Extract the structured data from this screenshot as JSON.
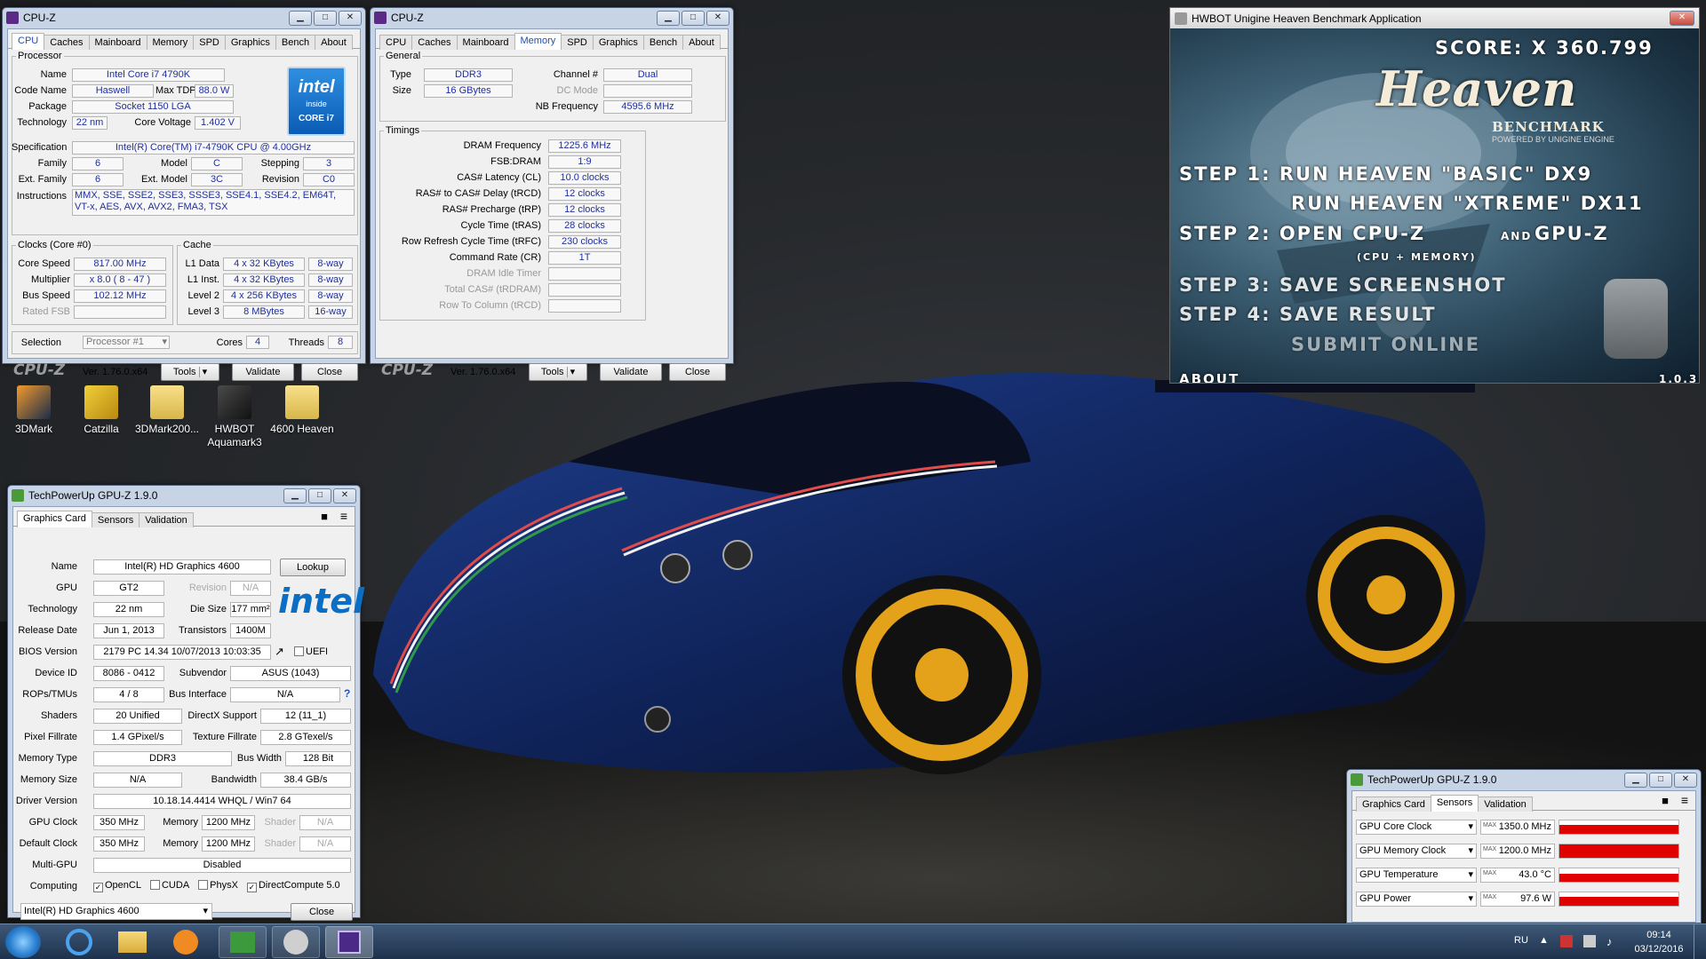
{
  "desktop": {
    "icons": [
      {
        "label": "3DMark"
      },
      {
        "label": "Catzilla"
      },
      {
        "label": "3DMark200..."
      },
      {
        "label": "HWBOT Aquamark3"
      },
      {
        "label": "4600 Heaven"
      }
    ]
  },
  "cpuz1": {
    "title": "CPU-Z",
    "tabs": [
      "CPU",
      "Caches",
      "Mainboard",
      "Memory",
      "SPD",
      "Graphics",
      "Bench",
      "About"
    ],
    "active_tab": "CPU",
    "processor": {
      "legend": "Processor",
      "name_label": "Name",
      "name": "Intel Core i7 4790K",
      "codename_label": "Code Name",
      "codename": "Haswell",
      "maxtdp_label": "Max TDP",
      "maxtdp": "88.0 W",
      "package_label": "Package",
      "package": "Socket 1150 LGA",
      "technology_label": "Technology",
      "technology": "22 nm",
      "corevoltage_label": "Core Voltage",
      "corevoltage": "1.402 V",
      "spec_label": "Specification",
      "spec": "Intel(R) Core(TM) i7-4790K CPU @ 4.00GHz",
      "family_label": "Family",
      "family": "6",
      "model_label": "Model",
      "model": "C",
      "stepping_label": "Stepping",
      "stepping": "3",
      "extfamily_label": "Ext. Family",
      "extfamily": "6",
      "extmodel_label": "Ext. Model",
      "extmodel": "3C",
      "revision_label": "Revision",
      "revision": "C0",
      "instructions_label": "Instructions",
      "instructions": "MMX, SSE, SSE2, SSE3, SSSE3, SSE4.1, SSE4.2, EM64T, VT-x, AES, AVX, AVX2, FMA3, TSX"
    },
    "badge": {
      "brand": "intel",
      "inside": "inside",
      "model": "CORE i7"
    },
    "clocks": {
      "legend": "Clocks (Core #0)",
      "corespeed_label": "Core Speed",
      "corespeed": "817.00 MHz",
      "multiplier_label": "Multiplier",
      "multiplier": "x 8.0 ( 8 - 47 )",
      "busspeed_label": "Bus Speed",
      "busspeed": "102.12 MHz",
      "ratedfsb_label": "Rated FSB",
      "ratedfsb": ""
    },
    "cache": {
      "legend": "Cache",
      "l1data_label": "L1 Data",
      "l1data": "4 x 32 KBytes",
      "l1data_way": "8-way",
      "l1inst_label": "L1 Inst.",
      "l1inst": "4 x 32 KBytes",
      "l1inst_way": "8-way",
      "l2_label": "Level 2",
      "l2": "4 x 256 KBytes",
      "l2_way": "8-way",
      "l3_label": "Level 3",
      "l3": "8 MBytes",
      "l3_way": "16-way"
    },
    "selection_label": "Selection",
    "selection": "Processor #1",
    "cores_label": "Cores",
    "cores": "4",
    "threads_label": "Threads",
    "threads": "8",
    "brand": "CPU-Z",
    "version": "Ver. 1.76.0.x64",
    "tools": "Tools",
    "validate": "Validate",
    "close": "Close"
  },
  "cpuz2": {
    "title": "CPU-Z",
    "tabs": [
      "CPU",
      "Caches",
      "Mainboard",
      "Memory",
      "SPD",
      "Graphics",
      "Bench",
      "About"
    ],
    "active_tab": "Memory",
    "general": {
      "legend": "General",
      "type_label": "Type",
      "type": "DDR3",
      "size_label": "Size",
      "size": "16 GBytes",
      "channel_label": "Channel #",
      "channel": "Dual",
      "dcmode_label": "DC Mode",
      "dcmode": "",
      "nbfreq_label": "NB Frequency",
      "nbfreq": "4595.6 MHz"
    },
    "timings": {
      "legend": "Timings",
      "rows": [
        {
          "label": "DRAM Frequency",
          "value": "1225.6 MHz",
          "dim": false
        },
        {
          "label": "FSB:DRAM",
          "value": "1:9",
          "dim": false
        },
        {
          "label": "CAS# Latency (CL)",
          "value": "10.0 clocks",
          "dim": false
        },
        {
          "label": "RAS# to CAS# Delay (tRCD)",
          "value": "12 clocks",
          "dim": false
        },
        {
          "label": "RAS# Precharge (tRP)",
          "value": "12 clocks",
          "dim": false
        },
        {
          "label": "Cycle Time (tRAS)",
          "value": "28 clocks",
          "dim": false
        },
        {
          "label": "Row Refresh Cycle Time (tRFC)",
          "value": "230 clocks",
          "dim": false
        },
        {
          "label": "Command Rate (CR)",
          "value": "1T",
          "dim": false
        },
        {
          "label": "DRAM Idle Timer",
          "value": "",
          "dim": true
        },
        {
          "label": "Total CAS# (tRDRAM)",
          "value": "",
          "dim": true
        },
        {
          "label": "Row To Column (tRCD)",
          "value": "",
          "dim": true
        }
      ]
    },
    "brand": "CPU-Z",
    "version": "Ver. 1.76.0.x64",
    "tools": "Tools",
    "validate": "Validate",
    "close": "Close"
  },
  "heaven": {
    "title": "HWBOT Unigine Heaven Benchmark Application",
    "score": "SCORE: X 360.799",
    "logo": "Heaven",
    "logo_sub": "BENCHMARK",
    "logo_powered": "POWERED BY UNIGINE ENGINE",
    "step1a": "STEP 1: RUN HEAVEN \"BASIC\" DX9",
    "step1b": "RUN HEAVEN \"XTREME\" DX11",
    "step2": "STEP 2: OPEN CPU-Z",
    "step2_and": "AND",
    "step2_gpuz": "GPU-Z",
    "step2_note": "(CPU + MEMORY)",
    "step3": "STEP 3: SAVE SCREENSHOT",
    "step4": "STEP 4: SAVE RESULT",
    "submit": "SUBMIT ONLINE",
    "about": "ABOUT",
    "version": "1.0.3"
  },
  "gpuz1": {
    "title": "TechPowerUp GPU-Z 1.9.0",
    "tabs": [
      "Graphics Card",
      "Sensors",
      "Validation"
    ],
    "active_tab": "Graphics Card",
    "name_label": "Name",
    "name": "Intel(R) HD Graphics 4600",
    "lookup": "Lookup",
    "gpu_label": "GPU",
    "gpu": "GT2",
    "revision_label": "Revision",
    "revision": "N/A",
    "technology_label": "Technology",
    "technology": "22 nm",
    "diesize_label": "Die Size",
    "diesize": "177 mm²",
    "release_label": "Release Date",
    "release": "Jun 1, 2013",
    "transistors_label": "Transistors",
    "transistors": "1400M",
    "bios_label": "BIOS Version",
    "bios": "2179 PC 14.34 10/07/2013 10:03:35",
    "uefi": "UEFI",
    "deviceid_label": "Device ID",
    "deviceid": "8086 - 0412",
    "subvendor_label": "Subvendor",
    "subvendor": "ASUS (1043)",
    "rops_label": "ROPs/TMUs",
    "rops": "4 / 8",
    "businterface_label": "Bus Interface",
    "businterface": "N/A",
    "shaders_label": "Shaders",
    "shaders": "20 Unified",
    "directx_label": "DirectX Support",
    "directx": "12 (11_1)",
    "pixel_label": "Pixel Fillrate",
    "pixel": "1.4 GPixel/s",
    "texture_label": "Texture Fillrate",
    "texture": "2.8 GTexel/s",
    "memtype_label": "Memory Type",
    "memtype": "DDR3",
    "buswidth_label": "Bus Width",
    "buswidth": "128 Bit",
    "memsize_label": "Memory Size",
    "memsize": "N/A",
    "bandwidth_label": "Bandwidth",
    "bandwidth": "38.4 GB/s",
    "driver_label": "Driver Version",
    "driver": "10.18.14.4414 WHQL / Win7 64",
    "gpuclock_label": "GPU Clock",
    "gpuclock": "350 MHz",
    "memory_label": "Memory",
    "gpuclock_mem": "1200 MHz",
    "shader_label": "Shader",
    "gpuclock_shader": "N/A",
    "defclock_label": "Default Clock",
    "defclock": "350 MHz",
    "defclock_mem": "1200 MHz",
    "defclock_shader": "N/A",
    "multigpu_label": "Multi-GPU",
    "multigpu": "Disabled",
    "computing_label": "Computing",
    "computing": [
      {
        "label": "OpenCL",
        "checked": true
      },
      {
        "label": "CUDA",
        "checked": false
      },
      {
        "label": "PhysX",
        "checked": false
      },
      {
        "label": "DirectCompute 5.0",
        "checked": true
      }
    ],
    "device_select": "Intel(R) HD Graphics 4600",
    "close": "Close",
    "brand": "intel"
  },
  "gpuz2": {
    "title": "TechPowerUp GPU-Z 1.9.0",
    "tabs": [
      "Graphics Card",
      "Sensors",
      "Validation"
    ],
    "active_tab": "Sensors",
    "sensors": [
      {
        "label": "GPU Core Clock",
        "prefix": "MAX",
        "value": "1350.0 MHz",
        "fill": 0.65
      },
      {
        "label": "GPU Memory Clock",
        "prefix": "MAX",
        "value": "1200.0 MHz",
        "fill": 1.0
      },
      {
        "label": "GPU Temperature",
        "prefix": "MAX",
        "value": "43.0 °C",
        "fill": 0.6
      },
      {
        "label": "GPU Power",
        "prefix": "MAX",
        "value": "97.6 W",
        "fill": 0.65
      }
    ]
  },
  "taskbar": {
    "lang": "RU",
    "time": "09:14",
    "date": "03/12/2016"
  }
}
